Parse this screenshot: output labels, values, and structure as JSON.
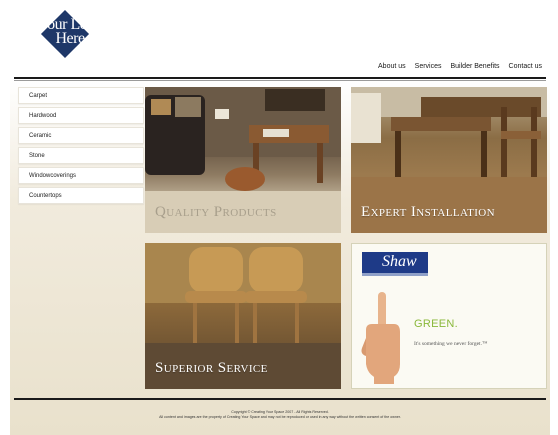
{
  "logo": {
    "line1": "Your Logo",
    "line2": "Here"
  },
  "nav": {
    "items": [
      "About us",
      "Services",
      "Builder Benefits",
      "Contact us"
    ]
  },
  "sidebar": {
    "items": [
      "Carpet",
      "Hardwood",
      "Ceramic",
      "Stone",
      "Windowcoverings",
      "Countertops"
    ]
  },
  "tiles": {
    "quality": "Quality Products",
    "installation": "Expert Installation",
    "service": "Superior Service"
  },
  "ad": {
    "brand": "Shaw",
    "headline": "GREEN.",
    "tagline": "It's something we never forget.™"
  },
  "footer": {
    "copyright": "Copyright © Creating Your Space 2007 - All Rights Reserved.",
    "notice": "All content and images are the property of Creating Your Space and may not be reproduced or used in any way without the written consent of the owner."
  },
  "colors": {
    "logo_blue": "#1e3768",
    "shaw_blue": "#1e3a87",
    "green": "#8ab83a",
    "rule": "#1a1a1a"
  },
  "icons": [
    "logo-diamond",
    "pointing-hand-icon"
  ]
}
